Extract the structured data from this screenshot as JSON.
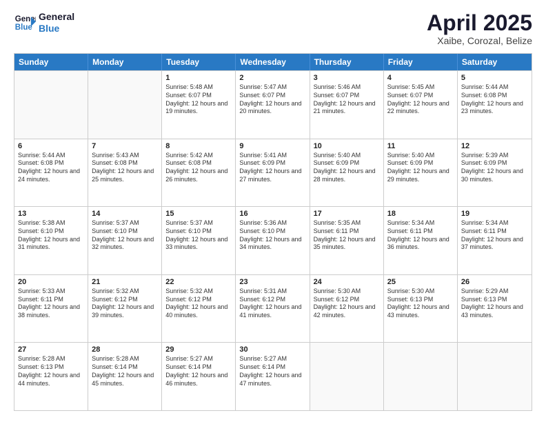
{
  "logo": {
    "line1": "General",
    "line2": "Blue"
  },
  "title": "April 2025",
  "subtitle": "Xaibe, Corozal, Belize",
  "days_of_week": [
    "Sunday",
    "Monday",
    "Tuesday",
    "Wednesday",
    "Thursday",
    "Friday",
    "Saturday"
  ],
  "weeks": [
    [
      {
        "day": "",
        "empty": true
      },
      {
        "day": "",
        "empty": true
      },
      {
        "day": "1",
        "sunrise": "5:48 AM",
        "sunset": "6:07 PM",
        "daylight": "12 hours and 19 minutes."
      },
      {
        "day": "2",
        "sunrise": "5:47 AM",
        "sunset": "6:07 PM",
        "daylight": "12 hours and 20 minutes."
      },
      {
        "day": "3",
        "sunrise": "5:46 AM",
        "sunset": "6:07 PM",
        "daylight": "12 hours and 21 minutes."
      },
      {
        "day": "4",
        "sunrise": "5:45 AM",
        "sunset": "6:07 PM",
        "daylight": "12 hours and 22 minutes."
      },
      {
        "day": "5",
        "sunrise": "5:44 AM",
        "sunset": "6:08 PM",
        "daylight": "12 hours and 23 minutes."
      }
    ],
    [
      {
        "day": "6",
        "sunrise": "5:44 AM",
        "sunset": "6:08 PM",
        "daylight": "12 hours and 24 minutes."
      },
      {
        "day": "7",
        "sunrise": "5:43 AM",
        "sunset": "6:08 PM",
        "daylight": "12 hours and 25 minutes."
      },
      {
        "day": "8",
        "sunrise": "5:42 AM",
        "sunset": "6:08 PM",
        "daylight": "12 hours and 26 minutes."
      },
      {
        "day": "9",
        "sunrise": "5:41 AM",
        "sunset": "6:09 PM",
        "daylight": "12 hours and 27 minutes."
      },
      {
        "day": "10",
        "sunrise": "5:40 AM",
        "sunset": "6:09 PM",
        "daylight": "12 hours and 28 minutes."
      },
      {
        "day": "11",
        "sunrise": "5:40 AM",
        "sunset": "6:09 PM",
        "daylight": "12 hours and 29 minutes."
      },
      {
        "day": "12",
        "sunrise": "5:39 AM",
        "sunset": "6:09 PM",
        "daylight": "12 hours and 30 minutes."
      }
    ],
    [
      {
        "day": "13",
        "sunrise": "5:38 AM",
        "sunset": "6:10 PM",
        "daylight": "12 hours and 31 minutes."
      },
      {
        "day": "14",
        "sunrise": "5:37 AM",
        "sunset": "6:10 PM",
        "daylight": "12 hours and 32 minutes."
      },
      {
        "day": "15",
        "sunrise": "5:37 AM",
        "sunset": "6:10 PM",
        "daylight": "12 hours and 33 minutes."
      },
      {
        "day": "16",
        "sunrise": "5:36 AM",
        "sunset": "6:10 PM",
        "daylight": "12 hours and 34 minutes."
      },
      {
        "day": "17",
        "sunrise": "5:35 AM",
        "sunset": "6:11 PM",
        "daylight": "12 hours and 35 minutes."
      },
      {
        "day": "18",
        "sunrise": "5:34 AM",
        "sunset": "6:11 PM",
        "daylight": "12 hours and 36 minutes."
      },
      {
        "day": "19",
        "sunrise": "5:34 AM",
        "sunset": "6:11 PM",
        "daylight": "12 hours and 37 minutes."
      }
    ],
    [
      {
        "day": "20",
        "sunrise": "5:33 AM",
        "sunset": "6:11 PM",
        "daylight": "12 hours and 38 minutes."
      },
      {
        "day": "21",
        "sunrise": "5:32 AM",
        "sunset": "6:12 PM",
        "daylight": "12 hours and 39 minutes."
      },
      {
        "day": "22",
        "sunrise": "5:32 AM",
        "sunset": "6:12 PM",
        "daylight": "12 hours and 40 minutes."
      },
      {
        "day": "23",
        "sunrise": "5:31 AM",
        "sunset": "6:12 PM",
        "daylight": "12 hours and 41 minutes."
      },
      {
        "day": "24",
        "sunrise": "5:30 AM",
        "sunset": "6:12 PM",
        "daylight": "12 hours and 42 minutes."
      },
      {
        "day": "25",
        "sunrise": "5:30 AM",
        "sunset": "6:13 PM",
        "daylight": "12 hours and 43 minutes."
      },
      {
        "day": "26",
        "sunrise": "5:29 AM",
        "sunset": "6:13 PM",
        "daylight": "12 hours and 43 minutes."
      }
    ],
    [
      {
        "day": "27",
        "sunrise": "5:28 AM",
        "sunset": "6:13 PM",
        "daylight": "12 hours and 44 minutes."
      },
      {
        "day": "28",
        "sunrise": "5:28 AM",
        "sunset": "6:14 PM",
        "daylight": "12 hours and 45 minutes."
      },
      {
        "day": "29",
        "sunrise": "5:27 AM",
        "sunset": "6:14 PM",
        "daylight": "12 hours and 46 minutes."
      },
      {
        "day": "30",
        "sunrise": "5:27 AM",
        "sunset": "6:14 PM",
        "daylight": "12 hours and 47 minutes."
      },
      {
        "day": "",
        "empty": true
      },
      {
        "day": "",
        "empty": true
      },
      {
        "day": "",
        "empty": true
      }
    ]
  ]
}
